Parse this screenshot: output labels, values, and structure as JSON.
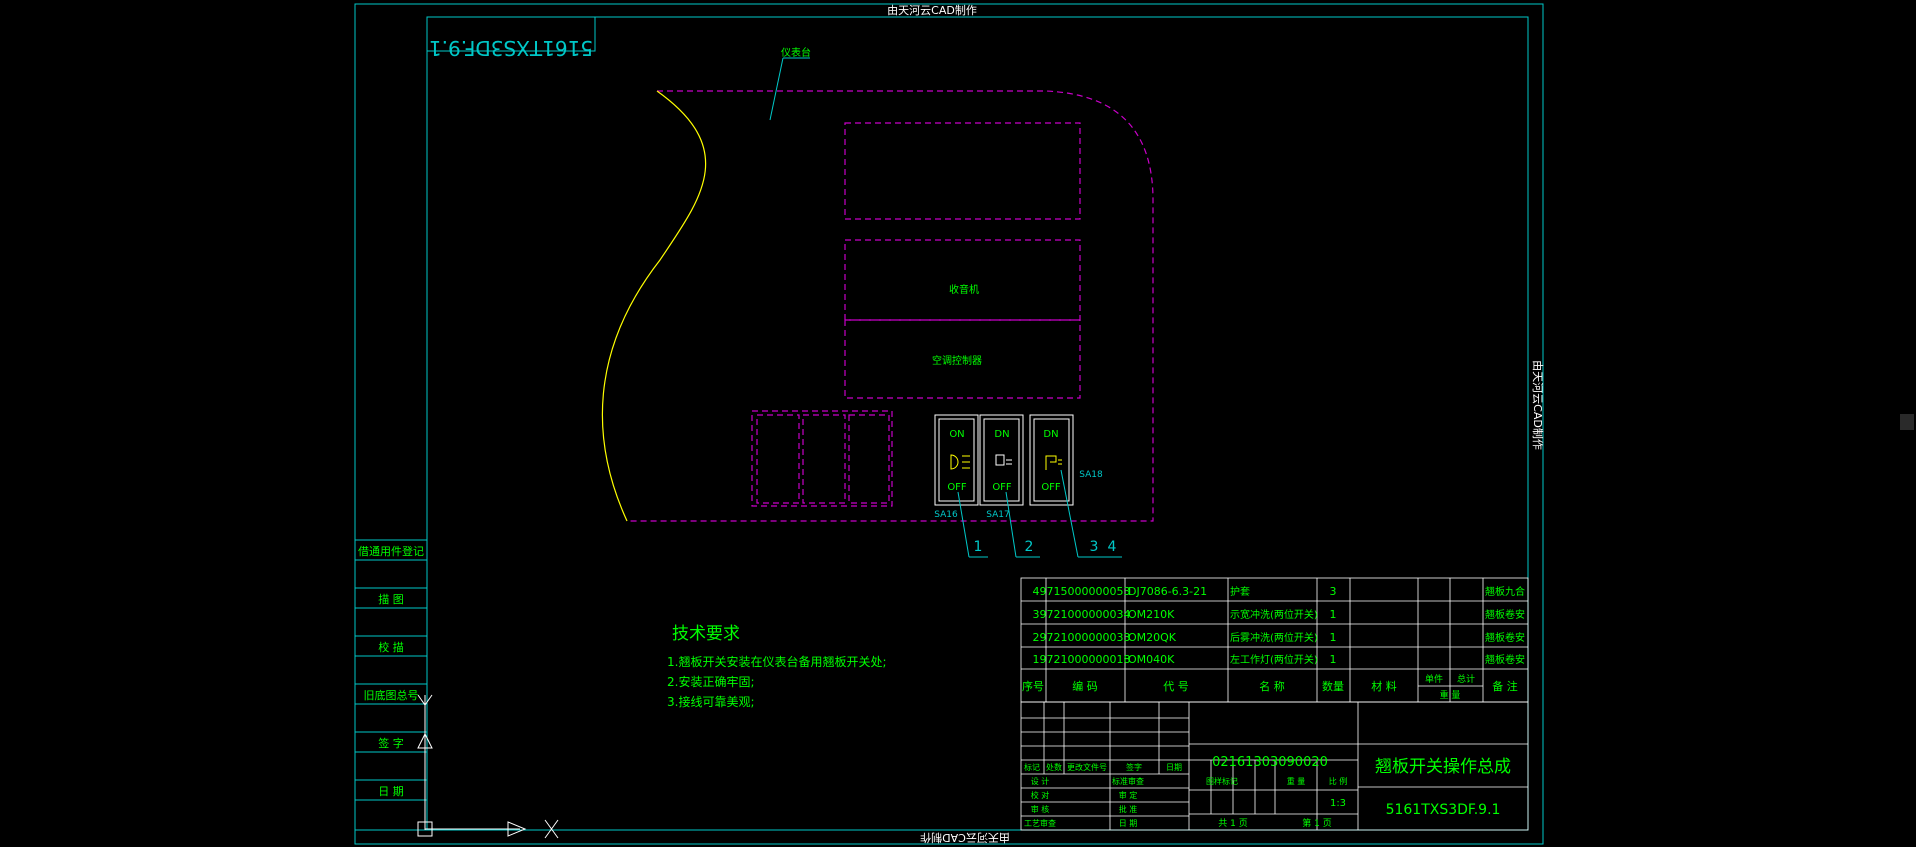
{
  "watermark": "由天河云CAD制作",
  "mirror_title": "5161TXS3DF.9.1",
  "top_leader_label": "仪表台",
  "box_labels": {
    "audio": "收音机",
    "ac": "空调控制器"
  },
  "switches": [
    {
      "on": "ON",
      "off": "OFF",
      "tag": "SA16"
    },
    {
      "on": "DN",
      "off": "OFF",
      "tag": "SA17"
    },
    {
      "on": "DN",
      "off": "OFF",
      "tag": "SA18"
    }
  ],
  "callouts": [
    "1",
    "2",
    "3",
    "4"
  ],
  "left_column": [
    "借通用件登记",
    "描  图",
    "校  描",
    "旧底图总号",
    "签  字",
    "日  期"
  ],
  "tech_req": {
    "title": "技术要求",
    "lines": [
      "1.翘板开关安装在仪表台备用翘板开关处;",
      "2.安装正确牢固;",
      "3.接线可靠美观;"
    ]
  },
  "bom": {
    "rows": [
      {
        "no": "4",
        "code": "9715000000053",
        "ref": "DJ7086-6.3-21",
        "name": "护套",
        "qty": "3",
        "note": "翘板九合"
      },
      {
        "no": "3",
        "code": "9721000000034",
        "ref": "OM210K",
        "name": "示宽冲洗(两位开关)",
        "qty": "1",
        "note": "翘板卷安"
      },
      {
        "no": "2",
        "code": "9721000000033",
        "ref": "OM20QK",
        "name": "后雾冲洗(两位开关)",
        "qty": "1",
        "note": "翘板卷安"
      },
      {
        "no": "1",
        "code": "9721000000018",
        "ref": "OM040K",
        "name": "左工作灯(两位开关)",
        "qty": "1",
        "note": "翘板卷安"
      }
    ],
    "headers": {
      "no": "序号",
      "code": "编  码",
      "ref": "代  号",
      "name": "名  称",
      "qty": "数量",
      "material": "材  料",
      "unit_total_top_a": "单件",
      "unit_total_top_b": "总计",
      "weight": "重  量",
      "note": "备  注"
    }
  },
  "title_block": {
    "drawing_no_top": "02161303090020",
    "title": "翘板开关操作总成",
    "drawing_no": "5161TXS3DF.9.1",
    "stage_mark": "图样标记",
    "weight": "重  量",
    "scale": "比  例",
    "scale_value": "1:3",
    "sheet_total": "共  1  页",
    "sheet_no": "第  1  页",
    "rev_labels": [
      "标记",
      "处数",
      "更改文件号",
      "签字",
      "日期"
    ],
    "sign_rows": [
      {
        "a": "设  计",
        "b": "标准审查"
      },
      {
        "a": "校  对",
        "b": "审  定"
      },
      {
        "a": "审  核",
        "b": "批  准"
      },
      {
        "a": "工艺审查",
        "b": "日  期"
      }
    ]
  },
  "colors": {
    "frame": "#00c8c8",
    "text": "#00ff00",
    "magenta": "#c800c8",
    "yellow": "#ffff00",
    "white": "#ffffff"
  }
}
